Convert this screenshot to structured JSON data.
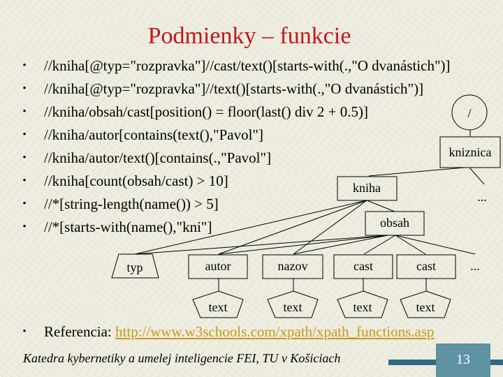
{
  "slide": {
    "title": "Podmienky – funkcie",
    "bullet_symbol": "•",
    "bullets": [
      "//kniha[@typ=\"rozpravka\"]//cast/text()[starts-with(.,\"O dvanástich\")]",
      "//kniha[@typ=\"rozpravka\"]//text()[starts-with(.,\"O dvanástich\")]",
      "//kniha/obsah/cast[position() = floor(last() div 2 + 0.5)]",
      "//kniha/autor[contains(text(),\"Pavol\"]",
      "//kniha/autor/text()[contains(.,\"Pavol\"]",
      "//kniha[count(obsah/cast) > 10]",
      "//*[string-length(name()) > 5]",
      "//*[starts-with(name(),\"kni\"]"
    ],
    "reference": {
      "label": "Referencia: ",
      "link_text": "http://www.w3schools.com/xpath/xpath_functions.asp"
    },
    "footer": "Katedra kybernetiky a umelej inteligencie FEI, TU v Košiciach",
    "page_number": "13",
    "colors": {
      "title": "#c8141c",
      "link": "#c79a16",
      "footer_bar": "#2d6b80",
      "page_box": "#6b9cab"
    }
  },
  "tree": {
    "root": "/",
    "kniznica": "kniznica",
    "kniznica_more": "...",
    "kniha": "kniha",
    "obsah": "obsah",
    "typ": "typ",
    "autor": "autor",
    "nazov": "nazov",
    "cast1": "cast",
    "cast2": "cast",
    "obsah_more": "...",
    "text_autor": "text",
    "text_nazov": "text",
    "text_cast1": "text",
    "text_cast2": "text"
  }
}
